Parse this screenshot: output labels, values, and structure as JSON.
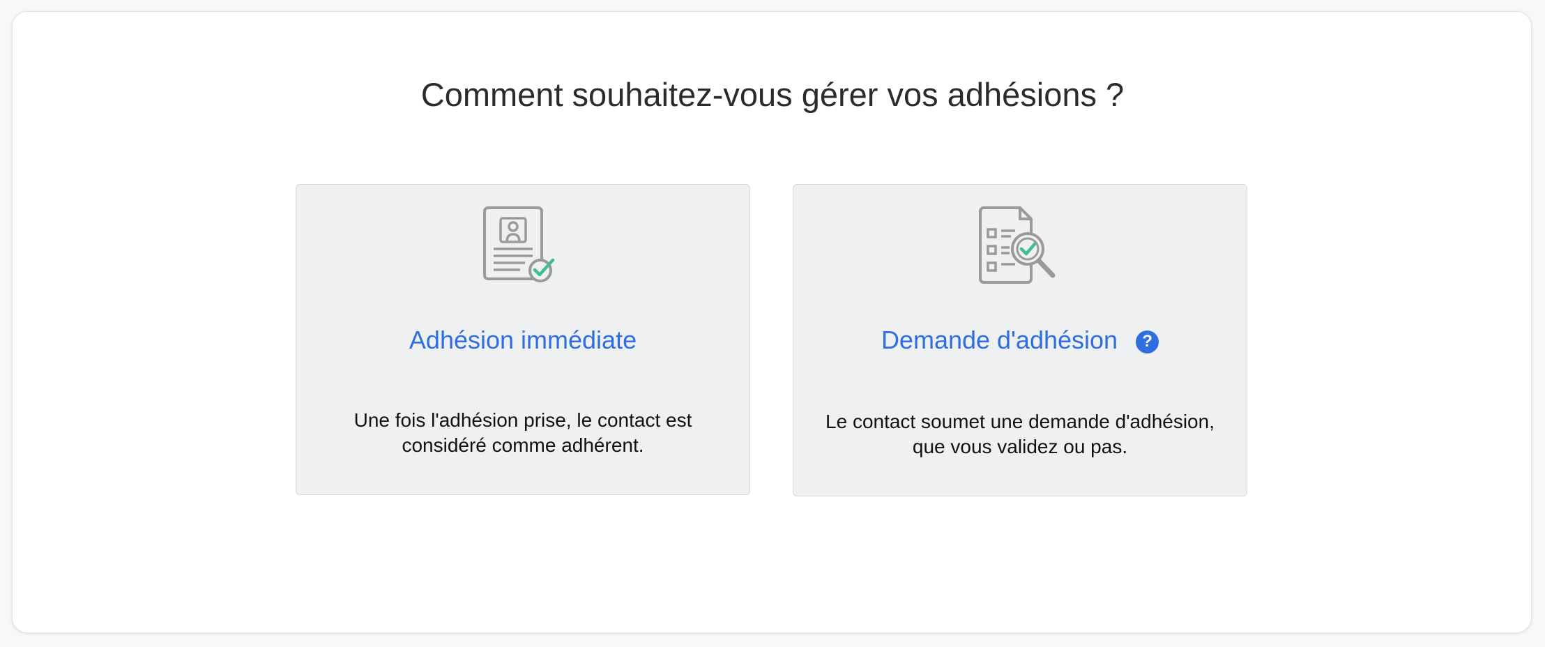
{
  "page": {
    "title": "Comment souhaitez-vous gérer vos adhésions ?"
  },
  "options": [
    {
      "title": "Adhésion immédiate",
      "description": "Une fois l'adhésion prise, le contact est considéré comme adhérent.",
      "icon": "member-card-check-icon"
    },
    {
      "title": "Demande d'adhésion",
      "description": "Le contact soumet une demande d'adhésion, que vous validez ou pas.",
      "icon": "checklist-magnifier-icon",
      "help_icon": "help-icon",
      "help_glyph": "?"
    }
  ],
  "colors": {
    "accent": "#2f6ee0",
    "check": "#3fbf8f",
    "icon_gray": "#9a9a9a",
    "card_bg": "#eef0f2"
  }
}
